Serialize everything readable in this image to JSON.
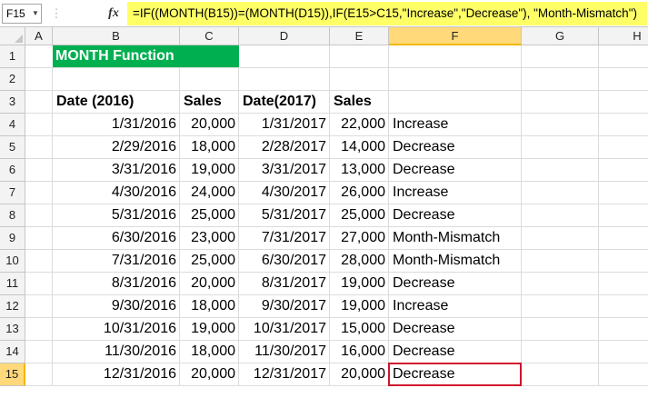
{
  "formula_bar": {
    "name_box": "F15",
    "fx_label": "fx",
    "formula": "=IF((MONTH(B15))=(MONTH(D15)),IF(E15>C15,\"Increase\",\"Decrease\"), \"Month-Mismatch\")"
  },
  "selected_cell": "F15",
  "columns": [
    "A",
    "B",
    "C",
    "D",
    "E",
    "F",
    "G",
    "H"
  ],
  "row_numbers": [
    "1",
    "2",
    "3",
    "4",
    "5",
    "6",
    "7",
    "8",
    "9",
    "10",
    "11",
    "12",
    "13",
    "14",
    "15"
  ],
  "title": "MONTH Function",
  "headers": {
    "b": "Date (2016)",
    "c": "Sales",
    "d": "Date(2017)",
    "e": "Sales"
  },
  "rows": [
    {
      "b": "1/31/2016",
      "c": "20,000",
      "d": "1/31/2017",
      "e": "22,000",
      "f": "Increase"
    },
    {
      "b": "2/29/2016",
      "c": "18,000",
      "d": "2/28/2017",
      "e": "14,000",
      "f": "Decrease"
    },
    {
      "b": "3/31/2016",
      "c": "19,000",
      "d": "3/31/2017",
      "e": "13,000",
      "f": "Decrease"
    },
    {
      "b": "4/30/2016",
      "c": "24,000",
      "d": "4/30/2017",
      "e": "26,000",
      "f": "Increase"
    },
    {
      "b": "5/31/2016",
      "c": "25,000",
      "d": "5/31/2017",
      "e": "25,000",
      "f": "Decrease"
    },
    {
      "b": "6/30/2016",
      "c": "23,000",
      "d": "7/31/2017",
      "e": "27,000",
      "f": "Month-Mismatch"
    },
    {
      "b": "7/31/2016",
      "c": "25,000",
      "d": "6/30/2017",
      "e": "28,000",
      "f": "Month-Mismatch"
    },
    {
      "b": "8/31/2016",
      "c": "20,000",
      "d": "8/31/2017",
      "e": "19,000",
      "f": "Decrease"
    },
    {
      "b": "9/30/2016",
      "c": "18,000",
      "d": "9/30/2017",
      "e": "19,000",
      "f": "Increase"
    },
    {
      "b": "10/31/2016",
      "c": "19,000",
      "d": "10/31/2017",
      "e": "15,000",
      "f": "Decrease"
    },
    {
      "b": "11/30/2016",
      "c": "18,000",
      "d": "11/30/2017",
      "e": "16,000",
      "f": "Decrease"
    },
    {
      "b": "12/31/2016",
      "c": "20,000",
      "d": "12/31/2017",
      "e": "20,000",
      "f": "Decrease"
    }
  ]
}
